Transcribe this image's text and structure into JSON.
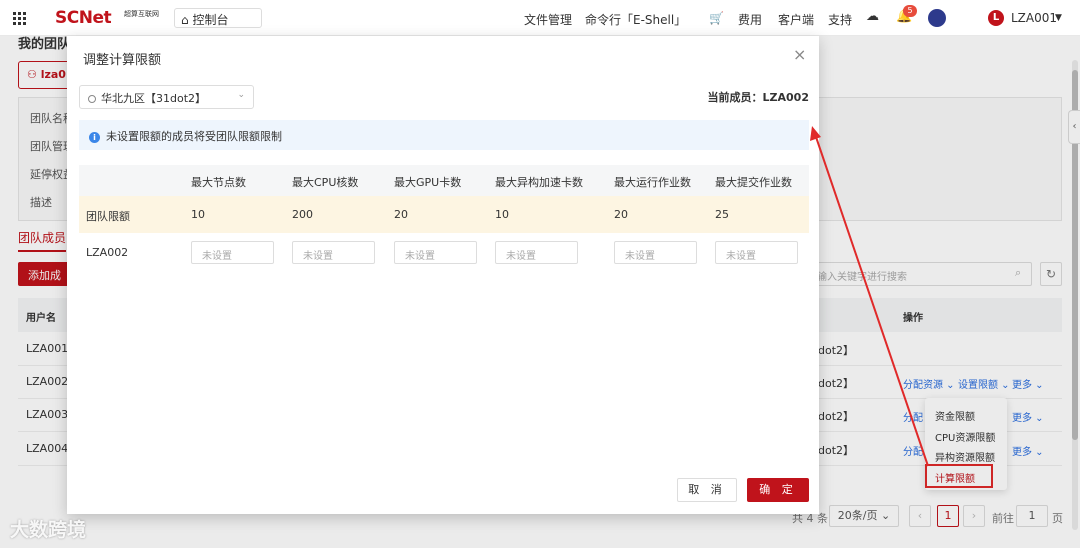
{
  "topbar": {
    "logo": "SCNet",
    "logo_sub": "超算互联网",
    "console": "控制台",
    "file_mgmt": "文件管理",
    "shell": "命令行「E-Shell」",
    "cost": "费用",
    "client": "客户端",
    "support": "支持",
    "notif_count": "5",
    "user_initial": "L",
    "user": "LZA001"
  },
  "background": {
    "team_title": "我的团队",
    "team_tag": "lza0",
    "info_labels": [
      "团队名称",
      "团队管理",
      "延停权益",
      "描述"
    ],
    "tab_members": "团队成员",
    "add_member": "添加成员",
    "search_placeholder": "输入关键字进行搜索",
    "col_username": "用户名",
    "col_actions": "操作",
    "rows": [
      {
        "user": "LZA001",
        "region": "dot2】"
      },
      {
        "user": "LZA002",
        "region": "dot2】"
      },
      {
        "user": "LZA003",
        "region": "dot2】"
      },
      {
        "user": "LZA004",
        "region": "dot2】"
      }
    ],
    "assign_resource": "分配资源",
    "set_quota": "设置限额",
    "more": "更多",
    "assign_short": "分配"
  },
  "dropdown": {
    "items": [
      "资金限额",
      "CPU资源限额",
      "异构资源限额",
      "计算限额"
    ]
  },
  "pagination": {
    "total": "共 4 条",
    "page_size": "20条/页",
    "current": "1",
    "goto": "前往",
    "goto_value": "1",
    "page_unit": "页"
  },
  "modal": {
    "title": "调整计算限额",
    "region": "华北九区【31dot2】",
    "current_member": "当前成员：LZA002",
    "notice": "未设置限额的成员将受团队限额限制",
    "headers": [
      "最大节点数",
      "最大CPU核数",
      "最大GPU卡数",
      "最大异构加速卡数",
      "最大运行作业数",
      "最大提交作业数"
    ],
    "team_row": {
      "label": "团队限额",
      "values": [
        "10",
        "200",
        "20",
        "10",
        "20",
        "25"
      ]
    },
    "member_row": {
      "label": "LZA002",
      "placeholder": "未设置"
    },
    "cancel": "取 消",
    "confirm": "确 定"
  },
  "watermark": "大数跨境",
  "colors": {
    "brand": "#c0131b",
    "link": "#2b6ee0",
    "annotation": "#e02a2a"
  }
}
